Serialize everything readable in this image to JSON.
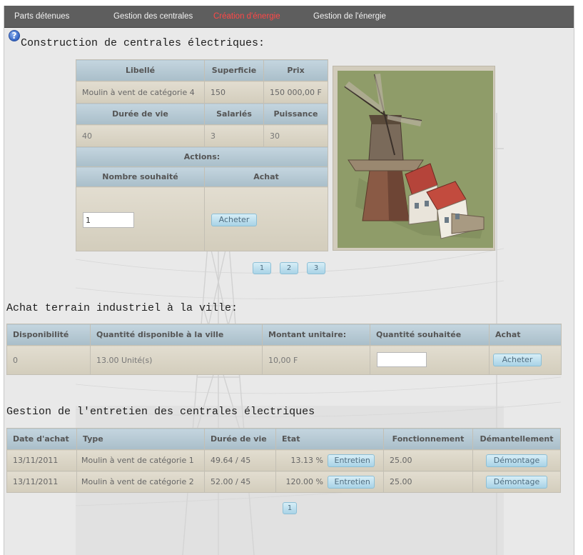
{
  "nav": {
    "items": [
      "Parts détenues",
      "Gestion des centrales",
      "Création d'énergie",
      "Gestion de l'énergie"
    ],
    "active": "Création d'énergie",
    "active_color": "#ff4747"
  },
  "construction": {
    "title": "Construction de centrales électriques:",
    "headers": {
      "libelle": "Libellé",
      "superficie": "Superficie",
      "prix": "Prix",
      "duree": "Durée de vie",
      "salaries": "Salariés",
      "puissance": "Puissance",
      "actions": "Actions:",
      "nombre": "Nombre souhaité",
      "achat": "Achat"
    },
    "values": {
      "libelle": "Moulin à vent de catégorie 4",
      "superficie": "150",
      "prix": "150 000,00 F",
      "duree": "40",
      "salaries": "3",
      "puissance": "30"
    },
    "quantity_value": "1",
    "buy_label": "Acheter",
    "image": "windmill-image",
    "pages": [
      "1",
      "2",
      "3"
    ]
  },
  "terrain": {
    "title": "Achat terrain industriel à la ville:",
    "headers": [
      "Disponibilité",
      "Quantité disponible à la ville",
      "Montant unitaire:",
      "Quantité souhaitée",
      "Achat"
    ],
    "row": {
      "disponibilite": "0",
      "quantite": "13.00 Unité(s)",
      "montant": "10,00 F",
      "souhaitee": ""
    },
    "buy_label": "Acheter"
  },
  "entretien": {
    "title": "Gestion de l'entretien des centrales électriques",
    "headers": [
      "Date d'achat",
      "Type",
      "Durée de vie",
      "Etat",
      "Fonctionnement",
      "Démantellement"
    ],
    "rows": [
      {
        "date": "13/11/2011",
        "type": "Moulin à vent de catégorie 1",
        "duree": "49.64 / 45",
        "etat": "13.13 %",
        "entretien": "Entretien",
        "fonctionnement": "25.00",
        "demontage": "Démontage"
      },
      {
        "date": "13/11/2011",
        "type": "Moulin à vent de catégorie 2",
        "duree": "52.00 / 45",
        "etat": "120.00 %",
        "entretien": "Entretien",
        "fonctionnement": "25.00",
        "demontage": "Démontage"
      }
    ],
    "pages": [
      "1"
    ]
  }
}
